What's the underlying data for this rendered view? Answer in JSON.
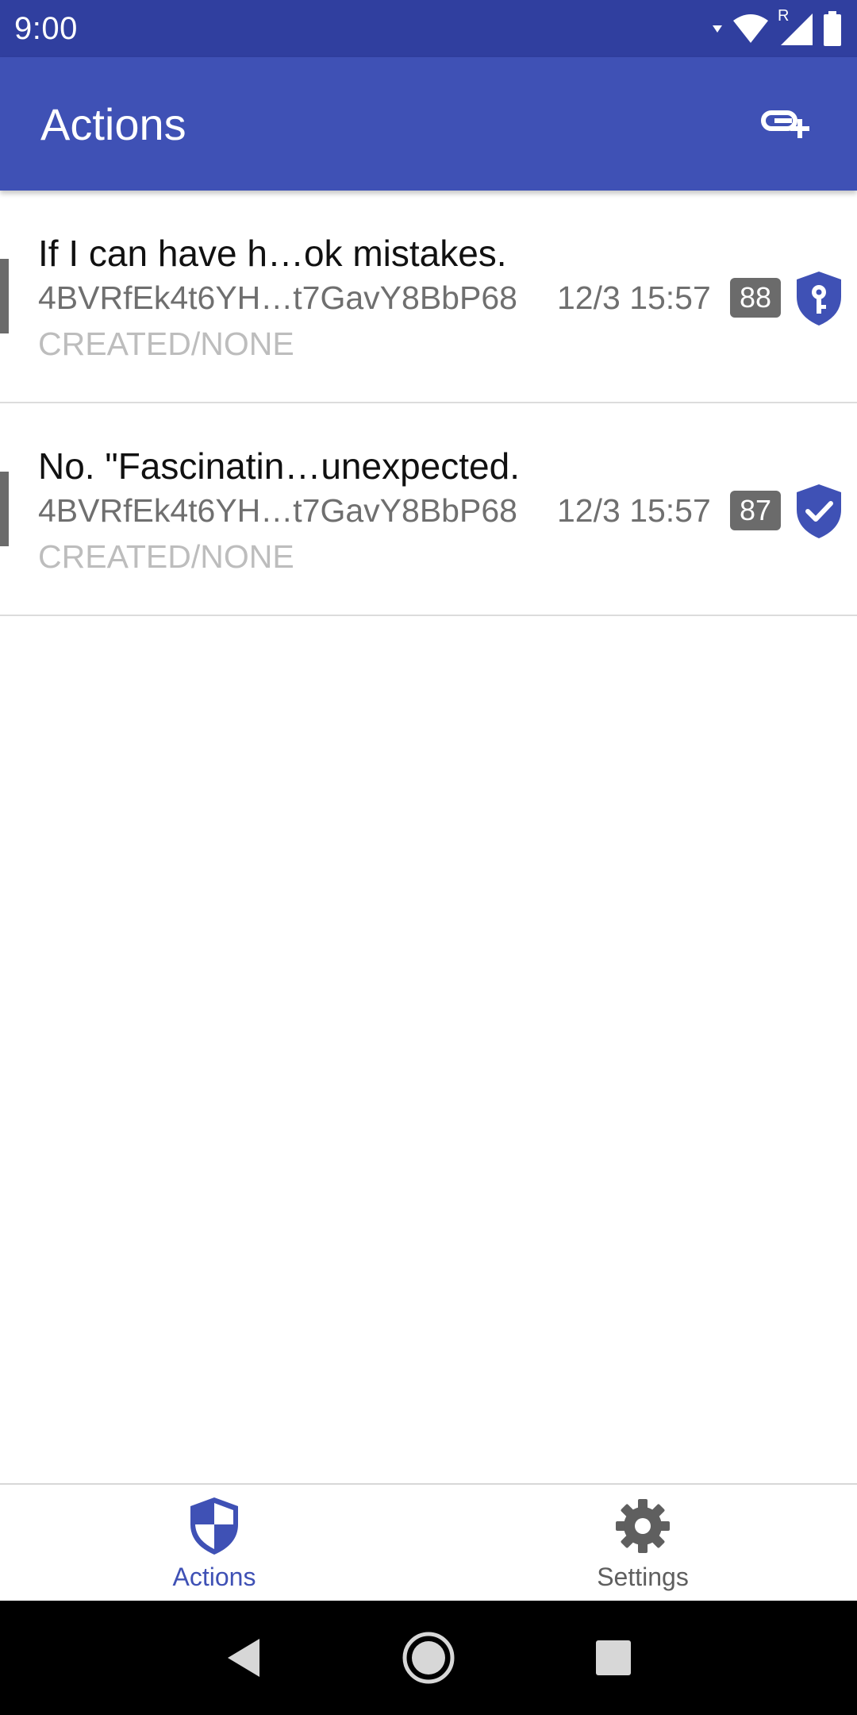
{
  "status_bar": {
    "time": "9:00",
    "icons": [
      "signal-arrow-icon",
      "wifi-icon",
      "roaming-indicator-icon",
      "cell-signal-icon",
      "battery-icon"
    ],
    "roaming_label": "R"
  },
  "app_bar": {
    "title": "Actions",
    "action_icon": "add-link-icon"
  },
  "actions": [
    {
      "title": "If I can have h…ok mistakes.",
      "address": "4BVRfEk4t6YH…t7GavY8BbP68",
      "state": "CREATED/NONE",
      "time": "12/3 15:57",
      "count": "88",
      "icon": "shield-key-icon"
    },
    {
      "title": "No. \"Fascinatin…unexpected.",
      "address": "4BVRfEk4t6YH…t7GavY8BbP68",
      "state": "CREATED/NONE",
      "time": "12/3 15:57",
      "count": "87",
      "icon": "shield-check-icon"
    }
  ],
  "bottom_nav": {
    "items": [
      {
        "label": "Actions",
        "icon": "shield-icon",
        "active": true
      },
      {
        "label": "Settings",
        "icon": "gear-icon",
        "active": false
      }
    ]
  },
  "system_nav": {
    "icons": [
      "back-icon",
      "home-icon",
      "recents-icon"
    ]
  },
  "colors": {
    "primary": "#3F51B5",
    "primary_dark": "#303F9F",
    "badge": "#6b6b6b"
  }
}
